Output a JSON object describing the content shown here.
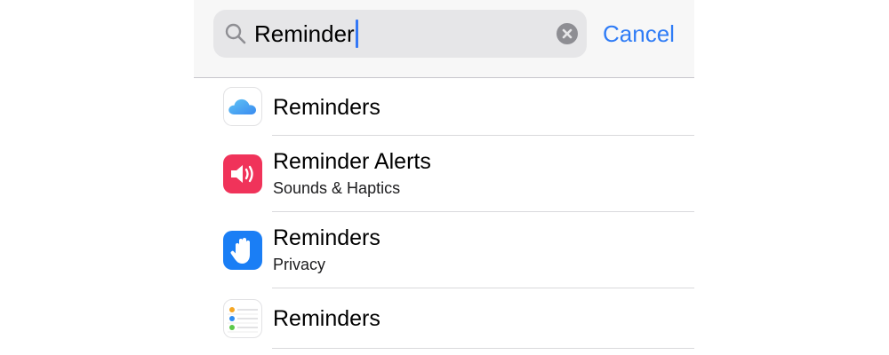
{
  "search": {
    "query": "Reminder",
    "cancel_label": "Cancel",
    "icon": "search-icon",
    "clear_icon": "clear-icon"
  },
  "results": [
    {
      "title": "Reminders",
      "subtitle": "",
      "icon": "icloud-icon",
      "icon_color": "#ffffff"
    },
    {
      "title": "Reminder Alerts",
      "subtitle": "Sounds & Haptics",
      "icon": "speaker-icon",
      "icon_color": "#f0335a"
    },
    {
      "title": "Reminders",
      "subtitle": "Privacy",
      "icon": "hand-icon",
      "icon_color": "#1a7ef5"
    },
    {
      "title": "Reminders",
      "subtitle": "",
      "icon": "reminders-app-icon",
      "icon_color": "#ffffff"
    }
  ],
  "colors": {
    "accent": "#2f7cf6",
    "header_bg": "#f7f7f7",
    "search_field_bg": "#e6e6e8"
  }
}
